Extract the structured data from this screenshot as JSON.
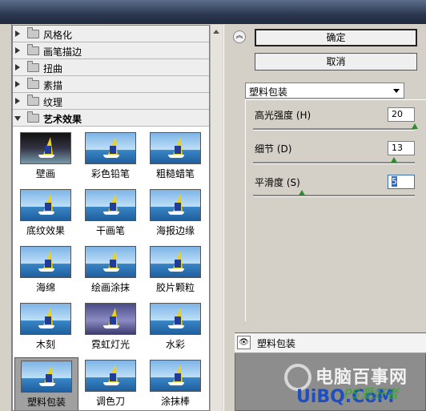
{
  "filter_categories": [
    {
      "label": "风格化",
      "expanded": false
    },
    {
      "label": "画笔描边",
      "expanded": false
    },
    {
      "label": "扭曲",
      "expanded": false
    },
    {
      "label": "素描",
      "expanded": false
    },
    {
      "label": "纹理",
      "expanded": false
    },
    {
      "label": "艺术效果",
      "expanded": true
    }
  ],
  "thumbnails": [
    {
      "label": "壁画"
    },
    {
      "label": "彩色铅笔"
    },
    {
      "label": "粗糙蜡笔"
    },
    {
      "label": "底纹效果"
    },
    {
      "label": "干画笔"
    },
    {
      "label": "海报边缘"
    },
    {
      "label": "海绵"
    },
    {
      "label": "绘画涂抹"
    },
    {
      "label": "胶片颗粒"
    },
    {
      "label": "木刻"
    },
    {
      "label": "霓虹灯光"
    },
    {
      "label": "水彩"
    },
    {
      "label": "塑料包装",
      "selected": true
    },
    {
      "label": "调色刀"
    },
    {
      "label": "涂抹棒"
    }
  ],
  "buttons": {
    "ok": "确定",
    "cancel": "取消"
  },
  "filter_select": {
    "value": "塑料包装"
  },
  "params": [
    {
      "label": "高光强度 (H)",
      "value": "20",
      "fraction": 1.0
    },
    {
      "label": "细节 (D)",
      "value": "13",
      "fraction": 0.87
    },
    {
      "label": "平滑度 (S)",
      "value": "5",
      "fraction": 0.3
    }
  ],
  "layer": {
    "name": "塑料包装"
  },
  "watermark": {
    "line1": "电脑百事网",
    "line2": "UiBQ.CoM",
    "line3": "PS爱好者"
  }
}
